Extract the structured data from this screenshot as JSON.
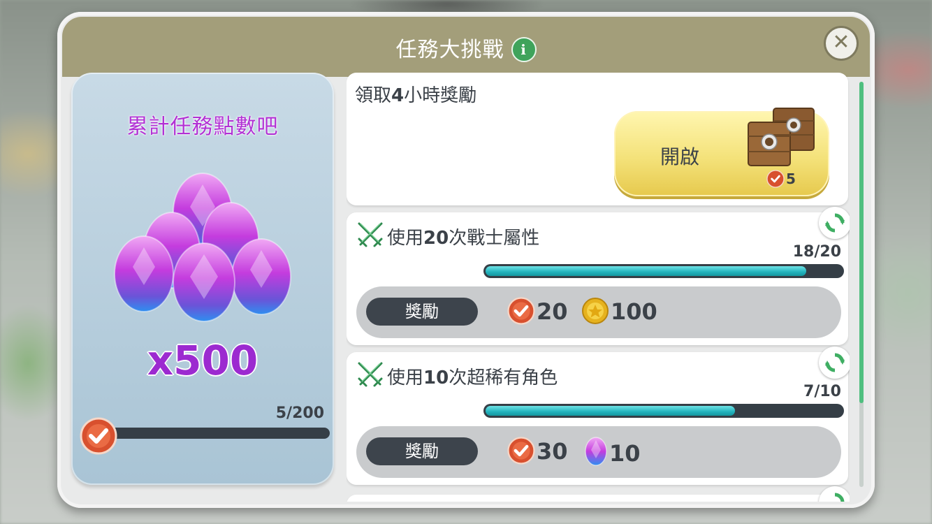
{
  "header": {
    "title": "任務大挑戰",
    "info_icon": "info-icon",
    "close_icon": "close-icon"
  },
  "left_panel": {
    "title": "累計任務點數吧",
    "reward_icon": "purple-gem-pile-icon",
    "amount": "x500",
    "progress_text": "5/200",
    "progress": 0.025
  },
  "timed_reward": {
    "label_pre": "領取",
    "label_bold": "4",
    "label_post": "小時獎勵",
    "button_label": "開啟",
    "button_icon": "treasure-chest-icon",
    "cost": "5"
  },
  "missions": [
    {
      "title_pre": "使用",
      "title_bold": "20",
      "title_post": "次戰士屬性",
      "progress_text": "18/20",
      "progress": 0.9,
      "reward_label": "獎勵",
      "rewards": [
        {
          "icon": "mission-point-icon",
          "value": "20"
        },
        {
          "icon": "gold-coin-icon",
          "value": "100"
        }
      ]
    },
    {
      "title_pre": "使用",
      "title_bold": "10",
      "title_post": "次超稀有角色",
      "progress_text": "7/10",
      "progress": 0.7,
      "reward_label": "獎勵",
      "rewards": [
        {
          "icon": "mission-point-icon",
          "value": "30"
        },
        {
          "icon": "purple-gem-icon",
          "value": "10"
        }
      ]
    }
  ],
  "colors": {
    "header": "#a39e7a",
    "accent_purple": "#9c2ad0",
    "progress_teal": "#22b3bd",
    "button_yellow": "#f4e27a",
    "check_red": "#d8502e"
  }
}
